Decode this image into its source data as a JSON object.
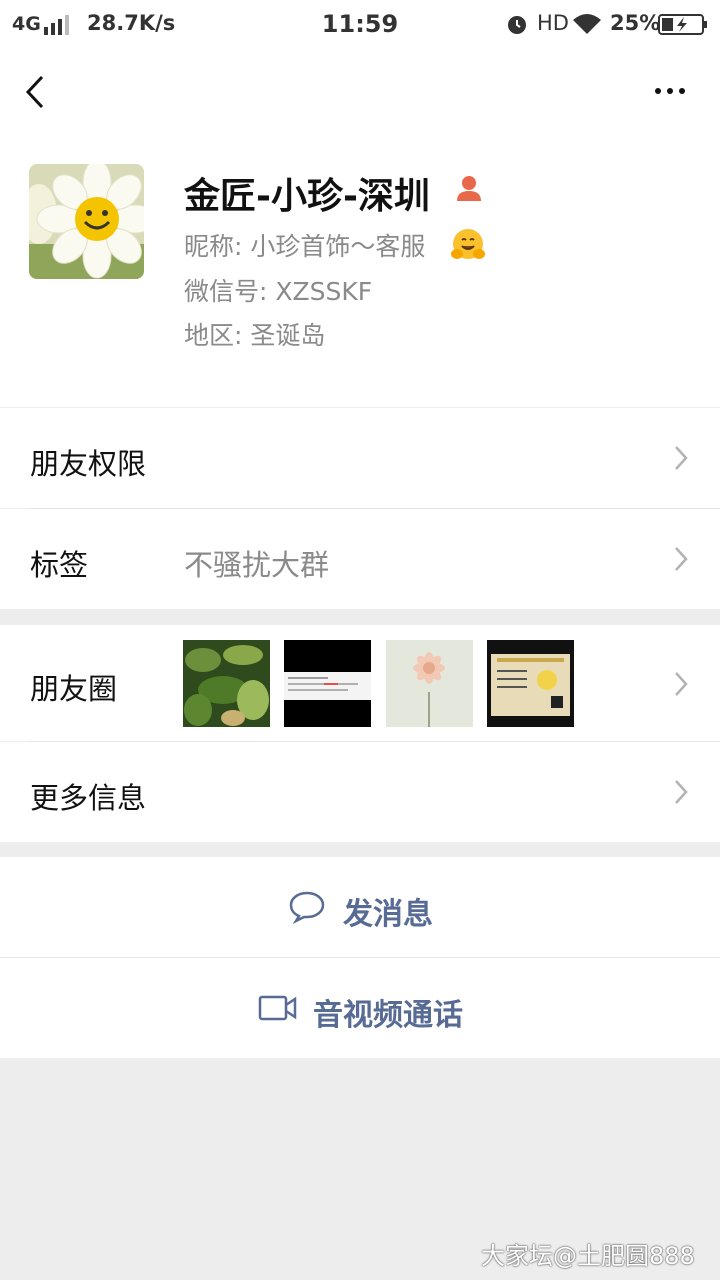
{
  "status_bar": {
    "network": "4G",
    "speed": "28.7K/s",
    "time": "11:59",
    "hd": "HD",
    "battery": "25%"
  },
  "profile": {
    "display_name": "金匠-小珍-深圳",
    "nickname": "昵称: 小珍首饰～客服",
    "wechat_id": "微信号: XZSSKF",
    "region": "地区: 圣诞岛"
  },
  "rows": {
    "friend_permissions": "朋友权限",
    "tags_label": "标签",
    "tags_value": "不骚扰大群",
    "moments_label": "朋友圈",
    "more_info": "更多信息"
  },
  "actions": {
    "send_message": "发消息",
    "video_call": "音视频通话"
  },
  "watermark": "大家坛@土肥圆888",
  "colors": {
    "link": "#576b95",
    "background": "#ededed",
    "secondary_text": "#8a8a8a"
  }
}
